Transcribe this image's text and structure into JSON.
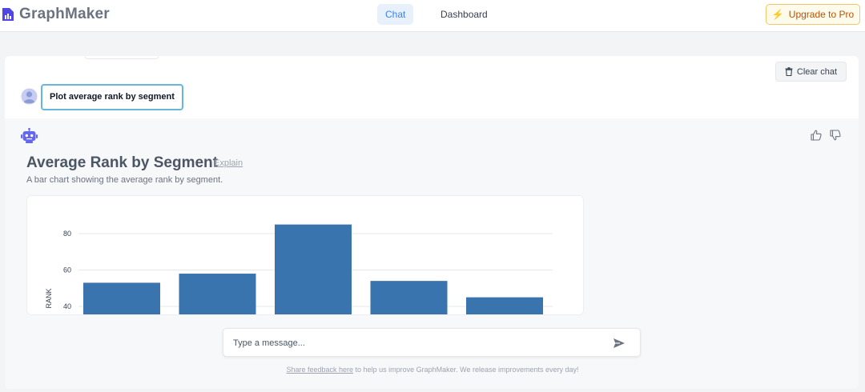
{
  "app": {
    "name": "GraphMaker"
  },
  "nav": {
    "tabs": [
      {
        "label": "Chat",
        "active": true
      },
      {
        "label": "Dashboard",
        "active": false
      }
    ],
    "upgrade_label": "Upgrade to Pro",
    "upgrade_icon": "lightning-bolt-icon"
  },
  "chat": {
    "clear_label": "Clear chat",
    "user_message": "Plot average rank by segment",
    "response": {
      "title": "Average Rank by Segment",
      "explain_label": "Explain",
      "description": "A bar chart showing the average rank by segment."
    }
  },
  "composer": {
    "placeholder": "Type a message...",
    "send_icon": "send-icon"
  },
  "footer": {
    "link_text": "Share feedback here",
    "rest_text": " to help us improve GraphMaker. We release improvements every day!"
  },
  "colors": {
    "accent": "#3b82f6",
    "bar": "#3a74af",
    "upgrade_border": "#f4c56a",
    "avatar": "#8b9ad8",
    "bot": "#6366f1"
  },
  "chart_data": {
    "type": "bar",
    "ylabel": "RANK",
    "yticks": [
      40,
      60,
      80
    ],
    "ylim": [
      40,
      90
    ],
    "grid": true,
    "series": [
      {
        "values": [
          53,
          58,
          85,
          54,
          45
        ]
      }
    ]
  }
}
